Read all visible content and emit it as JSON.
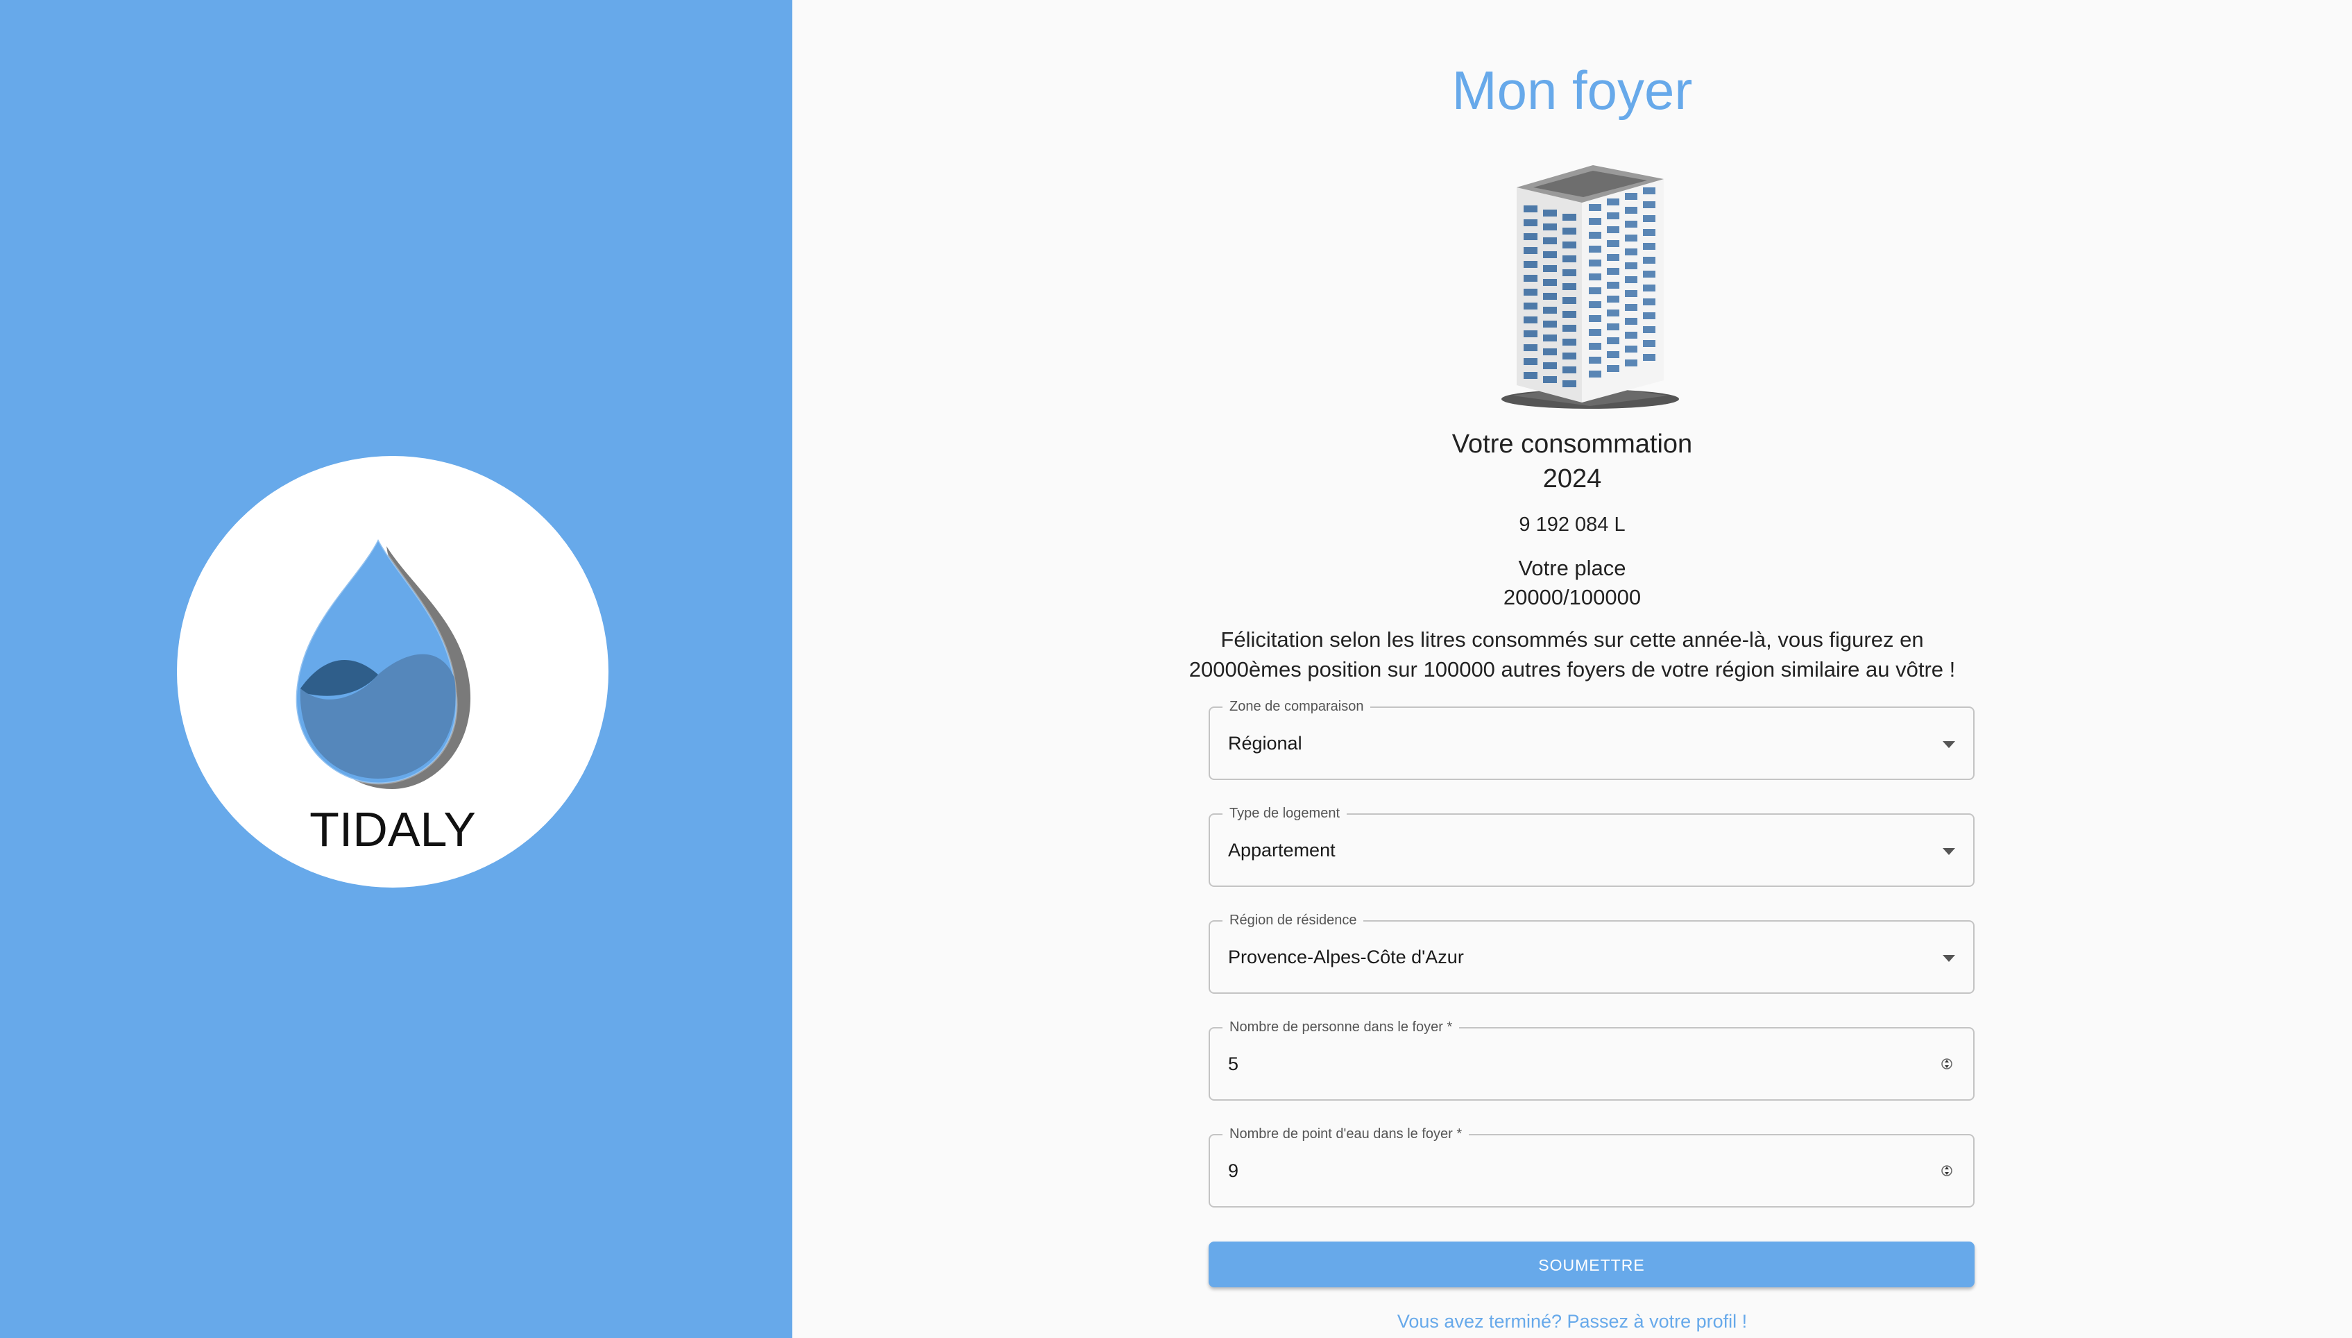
{
  "brand": {
    "name": "TIDALY",
    "colors": {
      "accent": "#67a9ea",
      "drop_dark": "#2f5e8a",
      "drop_mid": "#5587bb",
      "drop_shadow": "#7a7a7a"
    }
  },
  "page": {
    "title": "Mon foyer"
  },
  "housing_icon": "apartment-building-icon",
  "consumption": {
    "title": "Votre consommation",
    "year": "2024",
    "value": "9 192 084 L"
  },
  "ranking": {
    "label": "Votre place",
    "value": "20000/100000",
    "message_line1": "Félicitation selon les litres consommés sur cette année-là, vous figurez en",
    "message_line2": "20000èmes position sur 100000 autres foyers de votre région similaire au vôtre !"
  },
  "form": {
    "comparison_zone": {
      "label": "Zone de comparaison",
      "value": "Régional"
    },
    "housing_type": {
      "label": "Type de logement",
      "value": "Appartement"
    },
    "region": {
      "label": "Région de résidence",
      "value": "Provence-Alpes-Côte d'Azur"
    },
    "household_size": {
      "label": "Nombre de personne dans le foyer *",
      "value": "5"
    },
    "water_points": {
      "label": "Nombre de point d'eau dans le foyer *",
      "value": "9"
    },
    "submit_label": "SOUMETTRE"
  },
  "footer": {
    "profile_link": "Vous avez terminé? Passez à votre profil !"
  }
}
